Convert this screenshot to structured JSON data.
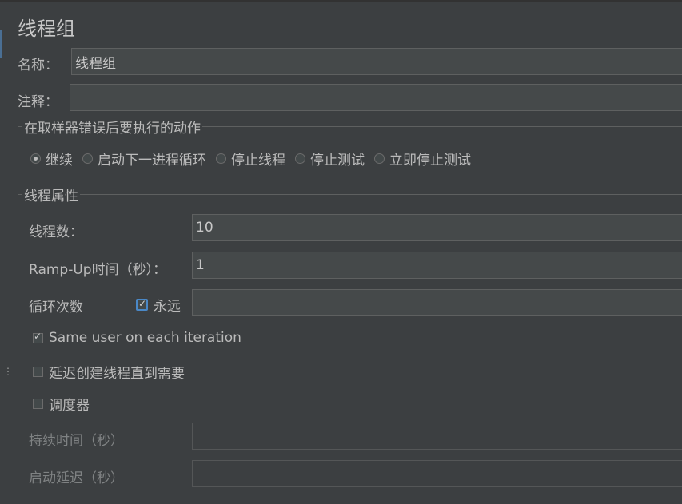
{
  "page_title": "线程组",
  "name": {
    "label": "名称：",
    "value": "线程组"
  },
  "comment": {
    "label": "注释：",
    "value": ""
  },
  "error_action": {
    "title": "在取样器错误后要执行的动作",
    "options": [
      "继续",
      "启动下一进程循环",
      "停止线程",
      "停止测试",
      "立即停止测试"
    ],
    "selected": "继续"
  },
  "thread_props": {
    "title": "线程属性",
    "num_threads": {
      "label": "线程数：",
      "value": "10"
    },
    "ramp_up": {
      "label": "Ramp-Up时间（秒）：",
      "value": "1"
    },
    "loop_count": {
      "label": "循环次数",
      "forever_label": "永远",
      "forever_checked": true,
      "value": ""
    },
    "same_user": {
      "label": "Same user on each iteration",
      "checked": true
    },
    "delay_create": {
      "label": "延迟创建线程直到需要",
      "checked": false
    },
    "scheduler": {
      "label": "调度器",
      "checked": false
    },
    "duration": {
      "label": "持续时间（秒）",
      "value": ""
    },
    "startup_delay": {
      "label": "启动延迟（秒）",
      "value": ""
    }
  },
  "colors": {
    "background": "#3c3f41",
    "field": "#45494a",
    "border": "#5e6060",
    "accent": "#4a88c7"
  }
}
